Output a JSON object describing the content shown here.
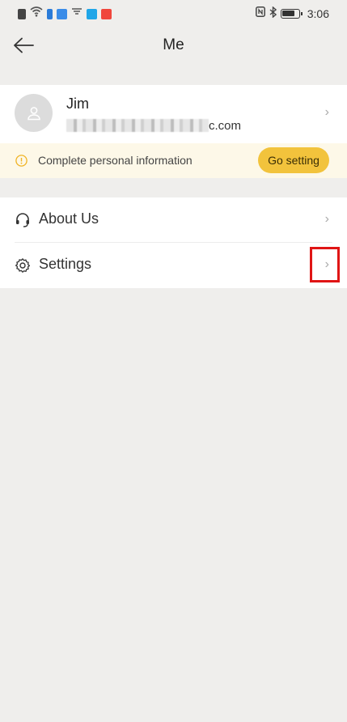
{
  "status_bar": {
    "time": "3:06"
  },
  "header": {
    "title": "Me"
  },
  "profile": {
    "name": "Jim",
    "email_suffix": "c.com"
  },
  "banner": {
    "text": "Complete personal information",
    "button_label": "Go setting"
  },
  "menu": {
    "items": [
      {
        "label": "About Us",
        "icon": "headset-icon"
      },
      {
        "label": "Settings",
        "icon": "gear-icon"
      }
    ]
  },
  "colors": {
    "background": "#efeeec",
    "banner_bg": "#fdf8e8",
    "accent_button": "#f2c33c",
    "highlight": "#e01515"
  }
}
